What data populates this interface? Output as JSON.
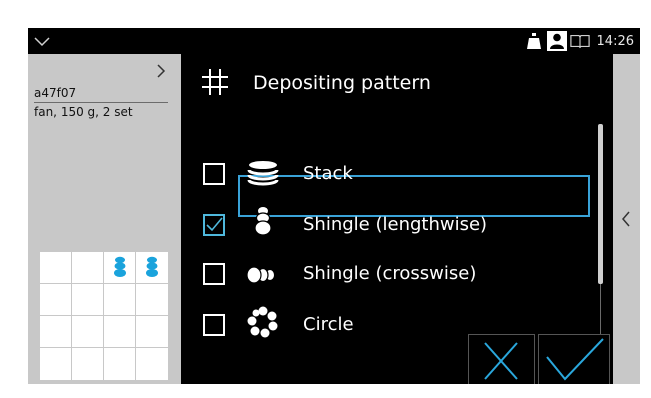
{
  "statusbar": {
    "time": "14:26",
    "icons": [
      "weight-icon",
      "user-icon",
      "manual-icon"
    ]
  },
  "product": {
    "id": "a47f07",
    "description": "fan, 150 g, 2 set"
  },
  "dialog": {
    "title": "Depositing pattern",
    "title_icon": "grid-hash-icon",
    "options": [
      {
        "label": "Stack",
        "icon": "stack-icon",
        "checked": false
      },
      {
        "label": "Shingle (lengthwise)",
        "icon": "shingle-lengthwise-icon",
        "checked": true,
        "highlighted": true
      },
      {
        "label": "Shingle (crosswise)",
        "icon": "shingle-crosswise-icon",
        "checked": false
      },
      {
        "label": "Circle",
        "icon": "circle-icon",
        "checked": false
      }
    ],
    "buttons": {
      "cancel": "close-icon",
      "confirm": "checkmark-icon"
    }
  },
  "colors": {
    "accent": "#3aa3d8",
    "panel": "#c8c8c8",
    "background": "#000000"
  }
}
